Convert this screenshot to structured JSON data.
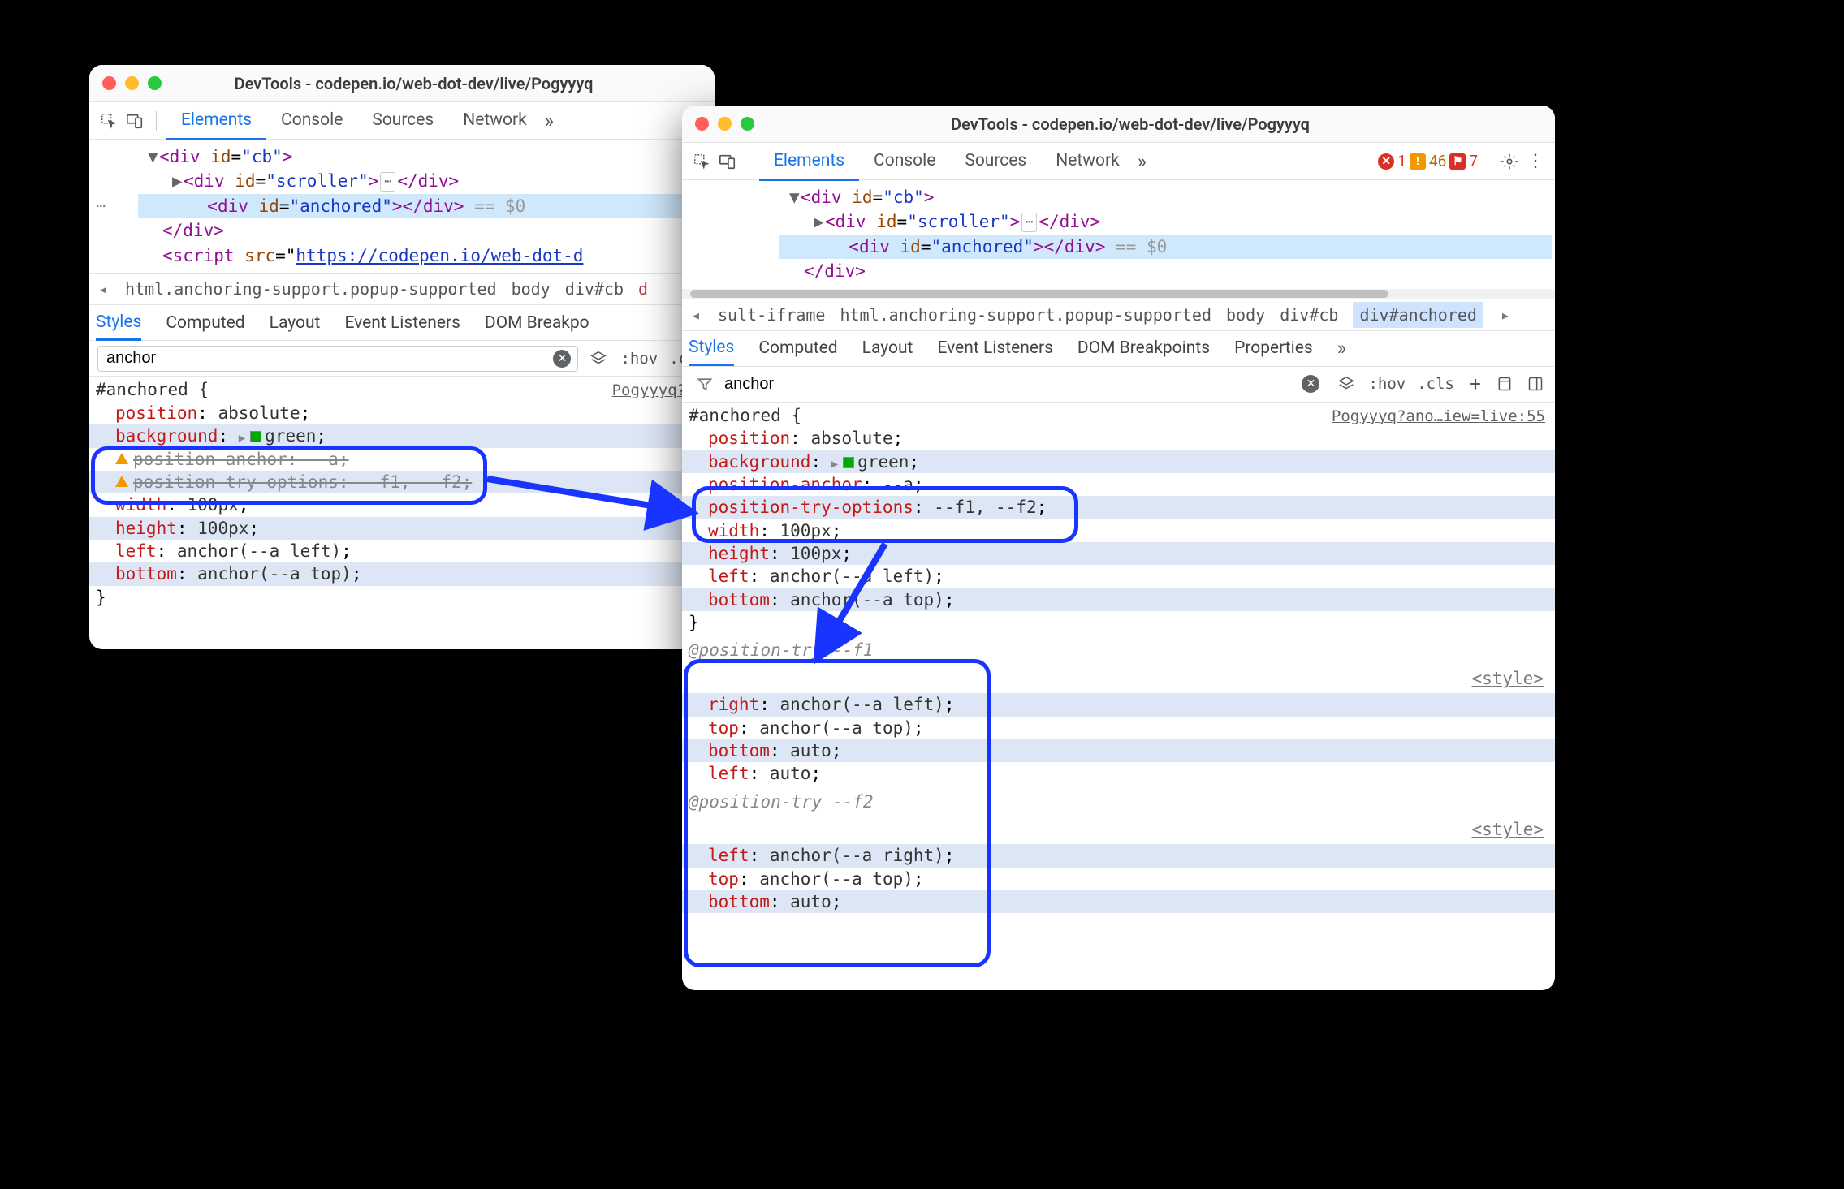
{
  "windows": {
    "w1": {
      "title": "DevTools - codepen.io/web-dot-dev/live/Pogyyyq",
      "main_tabs": [
        "Elements",
        "Console",
        "Sources",
        "Network"
      ],
      "active_main_tab": "Elements",
      "dom": {
        "line1_open": "<div id=\"cb\">",
        "line2_open": "<div id=\"scroller\">",
        "line2_close": "</div>",
        "line3_open": "<div id=\"anchored\">",
        "line3_close": "</div>",
        "line3_sel": "== $0",
        "line4": "</div>",
        "line5_a": "<script src=\"",
        "line5_b": "https://codepen.io/web-dot-d"
      },
      "crumbs": [
        "html.anchoring-support.popup-supported",
        "body",
        "div#cb"
      ],
      "subtabs": [
        "Styles",
        "Computed",
        "Layout",
        "Event Listeners",
        "DOM Breakpo"
      ],
      "active_subtab": "Styles",
      "filter_value": "anchor",
      "hov": ":hov",
      "cls": ".cls",
      "src_link": "Pogyyyq?an",
      "rule": {
        "selector": "#anchored {",
        "props": [
          {
            "n": "position",
            "v": "absolute",
            "stripe": false
          },
          {
            "n": "background",
            "v": "green",
            "stripe": true,
            "swatch": true
          },
          {
            "n": "position-anchor",
            "v": "--a",
            "stripe": false,
            "warn": true,
            "strike": true
          },
          {
            "n": "position-try-options",
            "v": "--f1, --f2",
            "stripe": true,
            "warn": true,
            "strike": true
          },
          {
            "n": "width",
            "v": "100px",
            "stripe": false
          },
          {
            "n": "height",
            "v": "100px",
            "stripe": true
          },
          {
            "n": "left",
            "v": "anchor(--a left)",
            "stripe": false
          },
          {
            "n": "bottom",
            "v": "anchor(--a top)",
            "stripe": true
          }
        ],
        "close": "}"
      }
    },
    "w2": {
      "title": "DevTools - codepen.io/web-dot-dev/live/Pogyyyq",
      "main_tabs": [
        "Elements",
        "Console",
        "Sources",
        "Network"
      ],
      "active_main_tab": "Elements",
      "errors": {
        "count": "1"
      },
      "warnings": {
        "count": "46"
      },
      "violations": {
        "count": "7"
      },
      "dom": {
        "line1_open": "<div id=\"cb\">",
        "line2_open": "<div id=\"scroller\">",
        "line2_close": "</div>",
        "line3_open": "<div id=\"anchored\">",
        "line3_close": "</div>",
        "line3_sel": "== $0",
        "line4": "</div>"
      },
      "crumbs_left_trunc": "sult-iframe",
      "crumbs": [
        "html.anchoring-support.popup-supported",
        "body",
        "div#cb",
        "div#anchored"
      ],
      "subtabs": [
        "Styles",
        "Computed",
        "Layout",
        "Event Listeners",
        "DOM Breakpoints",
        "Properties"
      ],
      "active_subtab": "Styles",
      "filter_value": "anchor",
      "hov": ":hov",
      "cls": ".cls",
      "src_link": "Pogyyyq?ano…iew=live:55",
      "rule": {
        "selector": "#anchored {",
        "props": [
          {
            "n": "position",
            "v": "absolute",
            "stripe": false
          },
          {
            "n": "background",
            "v": "green",
            "stripe": true,
            "swatch": true
          },
          {
            "n": "position-anchor",
            "v": "--a",
            "stripe": false
          },
          {
            "n": "position-try-options",
            "v": "--f1, --f2",
            "stripe": true
          },
          {
            "n": "width",
            "v": "100px",
            "stripe": false
          },
          {
            "n": "height",
            "v": "100px",
            "stripe": true
          },
          {
            "n": "left",
            "v": "anchor(--a left)",
            "stripe": false
          },
          {
            "n": "bottom",
            "v": "anchor(--a top)",
            "stripe": true
          }
        ],
        "close": "}"
      },
      "at_rules": [
        {
          "header": "@position-try --f1",
          "src": "<style>",
          "props": [
            {
              "n": "right",
              "v": "anchor(--a left)",
              "stripe": true
            },
            {
              "n": "top",
              "v": "anchor(--a top)",
              "stripe": false
            },
            {
              "n": "bottom",
              "v": "auto",
              "stripe": true
            },
            {
              "n": "left",
              "v": "auto",
              "stripe": false
            }
          ]
        },
        {
          "header": "@position-try --f2",
          "src": "<style>",
          "props": [
            {
              "n": "left",
              "v": "anchor(--a right)",
              "stripe": true
            },
            {
              "n": "top",
              "v": "anchor(--a top)",
              "stripe": false
            },
            {
              "n": "bottom",
              "v": "auto",
              "stripe": true
            }
          ]
        }
      ]
    }
  }
}
